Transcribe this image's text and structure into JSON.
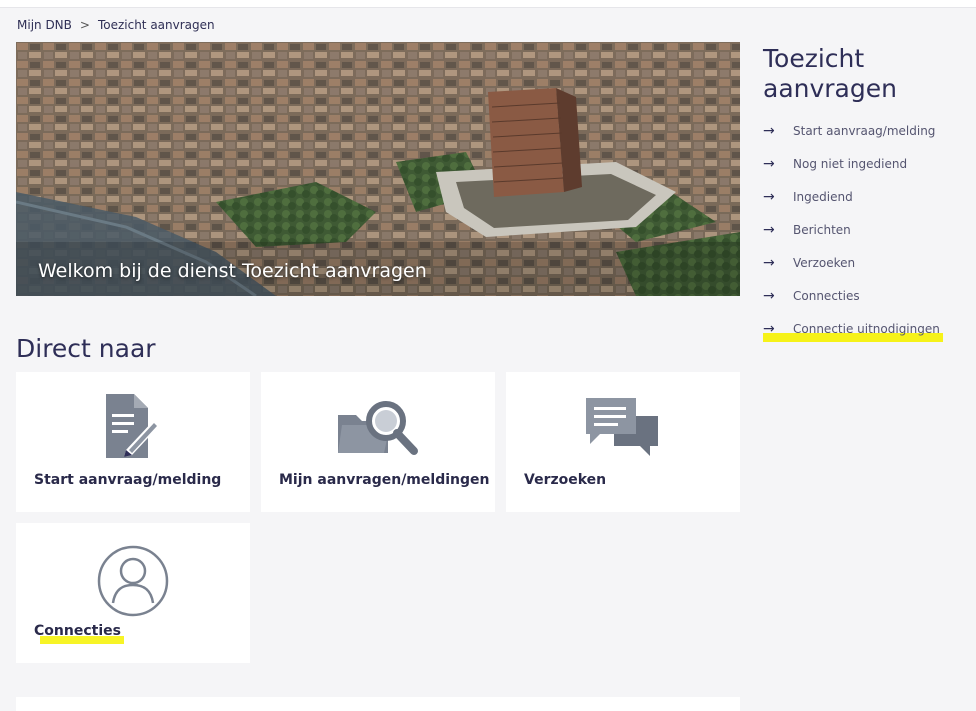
{
  "breadcrumb": {
    "home": "Mijn DNB",
    "separator": ">",
    "current": "Toezicht aanvragen"
  },
  "hero": {
    "title": "Welkom bij de dienst Toezicht aanvragen"
  },
  "direct": {
    "title": "Direct naar",
    "tiles": [
      {
        "label": "Start aanvraag/melding",
        "icon": "document-edit-icon"
      },
      {
        "label": "Mijn aanvragen/meldingen",
        "icon": "folder-search-icon"
      },
      {
        "label": "Verzoeken",
        "icon": "chat-bubbles-icon"
      },
      {
        "label": "Connecties",
        "icon": "user-circle-icon"
      }
    ]
  },
  "sidebar": {
    "title": "Toezicht aanvragen",
    "items": [
      {
        "label": "Start aanvraag/melding"
      },
      {
        "label": "Nog niet ingediend"
      },
      {
        "label": "Ingediend"
      },
      {
        "label": "Berichten"
      },
      {
        "label": "Verzoeken"
      },
      {
        "label": "Connecties"
      },
      {
        "label": "Connectie uitnodigingen"
      }
    ]
  },
  "colors": {
    "accent": "#2e2e57",
    "highlight": "#f6f200",
    "icon_gray": "#7a8290"
  }
}
